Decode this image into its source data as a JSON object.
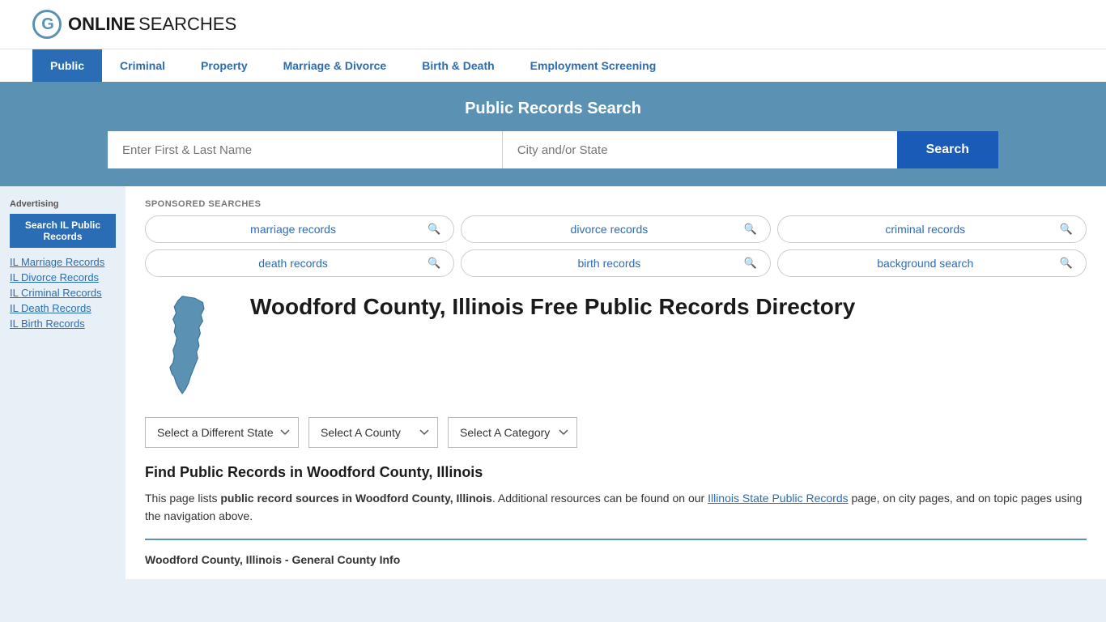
{
  "header": {
    "logo_online": "ONLINE",
    "logo_searches": "SEARCHES"
  },
  "nav": {
    "items": [
      {
        "label": "Public",
        "active": true
      },
      {
        "label": "Criminal",
        "active": false
      },
      {
        "label": "Property",
        "active": false
      },
      {
        "label": "Marriage & Divorce",
        "active": false
      },
      {
        "label": "Birth & Death",
        "active": false
      },
      {
        "label": "Employment Screening",
        "active": false
      }
    ]
  },
  "search_banner": {
    "title": "Public Records Search",
    "name_placeholder": "Enter First & Last Name",
    "location_placeholder": "City and/or State",
    "button_label": "Search"
  },
  "sponsored": {
    "label": "SPONSORED SEARCHES",
    "pills": [
      {
        "text": "marriage records"
      },
      {
        "text": "divorce records"
      },
      {
        "text": "criminal records"
      },
      {
        "text": "death records"
      },
      {
        "text": "birth records"
      },
      {
        "text": "background search"
      }
    ]
  },
  "page": {
    "title": "Woodford County, Illinois Free Public Records Directory",
    "dropdowns": {
      "state_label": "Select a Different State",
      "county_label": "Select A County",
      "category_label": "Select A Category"
    },
    "find_title": "Find Public Records in Woodford County, Illinois",
    "find_desc_1": "This page lists ",
    "find_desc_bold": "public record sources in Woodford County, Illinois",
    "find_desc_2": ". Additional resources can be found on our ",
    "find_link": "Illinois State Public Records",
    "find_desc_3": " page, on city pages, and on topic pages using the navigation above.",
    "general_info_label": "Woodford County, Illinois - General County Info"
  },
  "sidebar": {
    "ad_label": "Advertising",
    "ad_button": "Search IL Public Records",
    "links": [
      "IL Marriage Records",
      "IL Divorce Records",
      "IL Criminal Records",
      "IL Death Records",
      "IL Birth Records"
    ]
  }
}
